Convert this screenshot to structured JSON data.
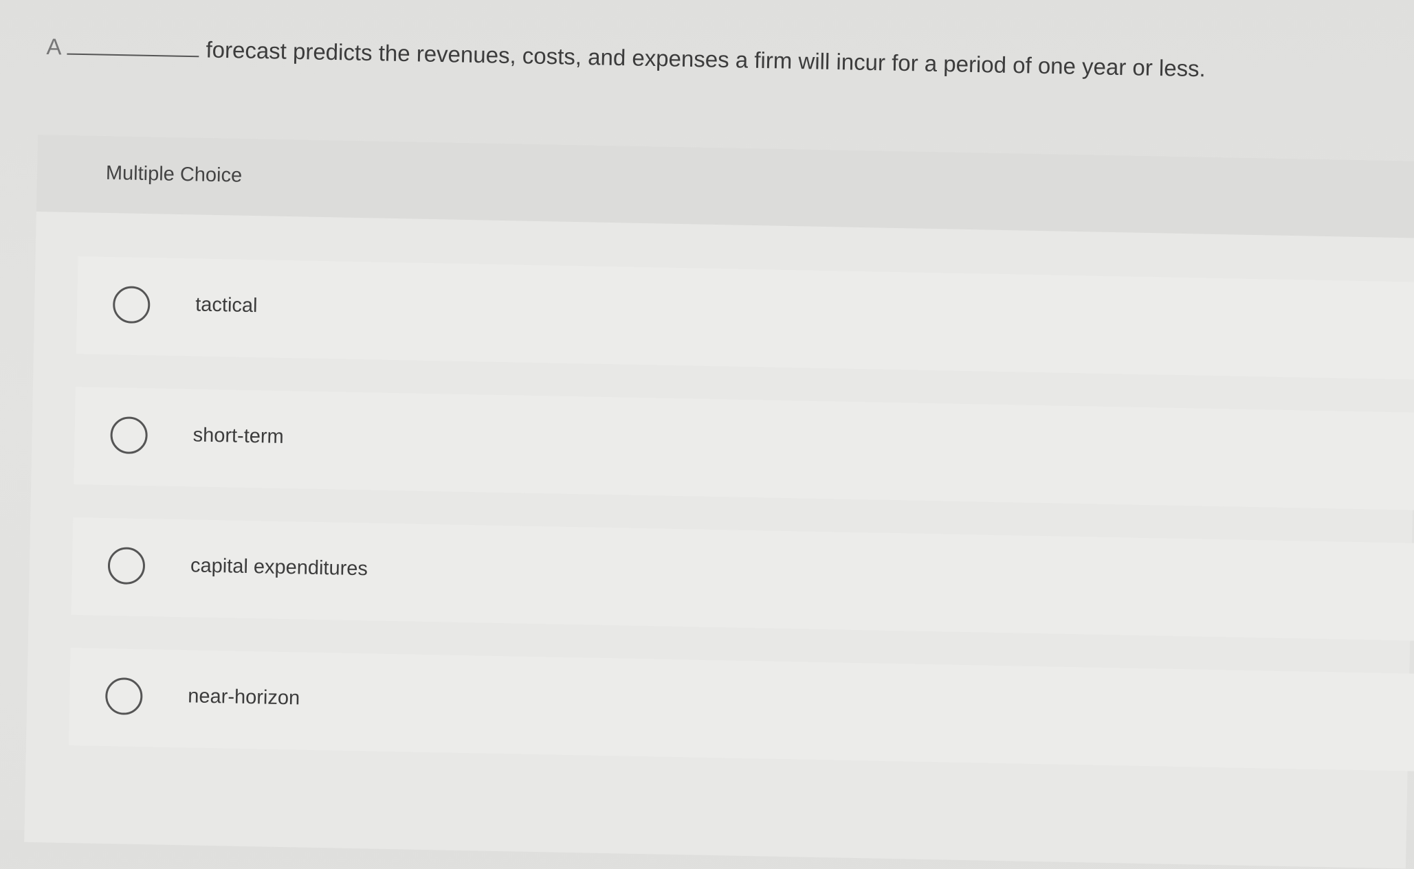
{
  "question": {
    "article": "A",
    "text": "forecast predicts the revenues, costs, and expenses a firm will incur for a period of one year or less."
  },
  "multiple_choice": {
    "title": "Multiple Choice",
    "options": [
      {
        "label": "tactical"
      },
      {
        "label": "short-term"
      },
      {
        "label": "capital expenditures"
      },
      {
        "label": "near-horizon"
      }
    ]
  }
}
